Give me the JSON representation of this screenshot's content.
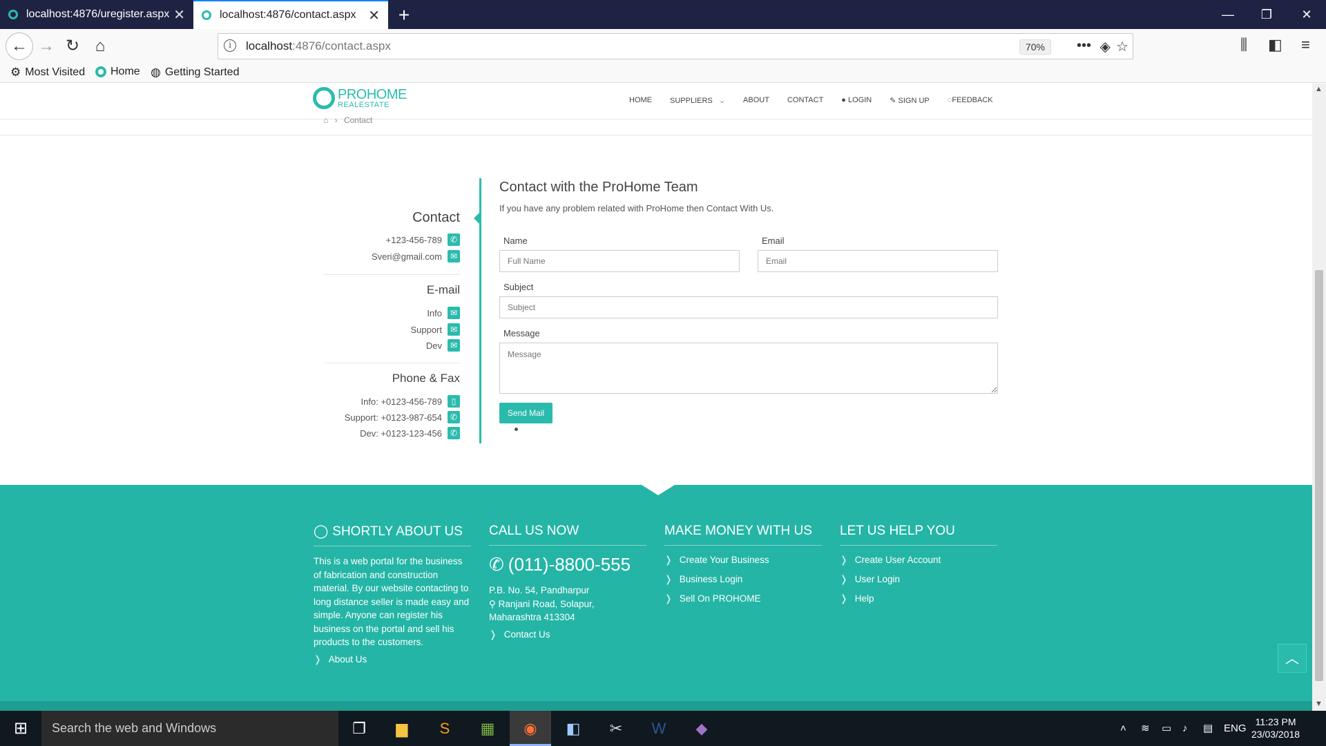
{
  "browser": {
    "tabs": [
      {
        "title": "localhost:4876/uregister.aspx"
      },
      {
        "title": "localhost:4876/contact.aspx"
      }
    ],
    "url_host": "localhost",
    "url_rest": ":4876/contact.aspx",
    "zoom": "70%",
    "bookmarks": [
      "Most Visited",
      "Home",
      "Getting Started"
    ]
  },
  "site": {
    "logo_name": "PROHOME",
    "logo_sub": "REALESTATE",
    "nav": [
      "HOME",
      "SUPPLIERS",
      "ABOUT",
      "CONTACT",
      "LOGIN",
      "SIGN UP",
      "FEEDBACK"
    ],
    "breadcrumb": "Contact"
  },
  "contact_sidebar": {
    "contact_title": "Contact",
    "phone": "+123-456-789",
    "email": "Sveri@gmail.com",
    "email_title": "E-mail",
    "email_items": [
      "Info",
      "Support",
      "Dev"
    ],
    "phonefax_title": "Phone & Fax",
    "phonefax_items": [
      "Info: +0123-456-789",
      "Support: +0123-987-654",
      "Dev: +0123-123-456"
    ]
  },
  "form": {
    "title": "Contact with the ProHome Team",
    "subtitle": "If you have any problem related with ProHome then Contact With Us.",
    "name_label": "Name",
    "name_placeholder": "Full Name",
    "email_label": "Email",
    "email_placeholder": "Email",
    "subject_label": "Subject",
    "subject_placeholder": "Subject",
    "message_label": "Message",
    "message_placeholder": "Message",
    "send_label": "Send Mail"
  },
  "footer": {
    "about_title": "SHORTLY ABOUT US",
    "about_text": "This is a web portal for the business of fabrication and construction material. By our website contacting to long distance seller is made easy and simple. Anyone can register his business on the portal and sell his products to the customers.",
    "about_link": "About Us",
    "call_title": "CALL US NOW",
    "phone": "(011)-8800-555",
    "address_1": "P.B. No. 54, ",
    "address_city": "Pandharpur",
    "address_2": "Ranjani Road, Solapur, Maharashtra 413304",
    "contact_link": "Contact Us",
    "money_title": "MAKE MONEY WITH US",
    "money_links": [
      "Create Your Business",
      "Business Login",
      "Sell On PROHOME"
    ],
    "help_title": "LET US HELP YOU",
    "help_links": [
      "Create User Account",
      "User Login",
      "Help"
    ]
  },
  "taskbar": {
    "search_placeholder": "Search the web and Windows",
    "language": "ENG",
    "time": "11:23 PM",
    "date": "23/03/2018"
  },
  "colors": {
    "accent": "#2bbbad",
    "footer": "#24b5a6",
    "tabbar": "#1f2343"
  }
}
